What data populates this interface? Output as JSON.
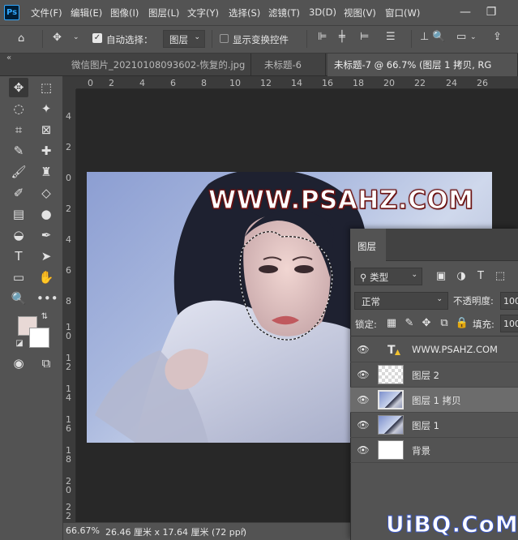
{
  "app": {
    "logo": "Ps"
  },
  "menu": [
    "文件(F)",
    "编辑(E)",
    "图像(I)",
    "图层(L)",
    "文字(Y)",
    "选择(S)",
    "滤镜(T)",
    "3D(D)",
    "视图(V)",
    "窗口(W)"
  ],
  "window_controls": {
    "minimize": "—",
    "restore": "❐"
  },
  "options_bar": {
    "auto_select_label": "自动选择：",
    "auto_select_checked": true,
    "auto_select_target": "图层",
    "show_transform_label": "显示变换控件",
    "show_transform_checked": false
  },
  "tabs": [
    {
      "label": "微信图片_20210108093602-恢复的.jpg",
      "active": false
    },
    {
      "label": "未标题-6",
      "active": false
    },
    {
      "label": "未标题-7 @ 66.7% (图层 1 拷贝, RG",
      "active": true
    }
  ],
  "ruler": {
    "top": [
      "0",
      "2",
      "4",
      "6",
      "8",
      "10",
      "12",
      "14",
      "16",
      "18",
      "20",
      "22",
      "24",
      "26"
    ],
    "left": [
      "4",
      "2",
      "0",
      "2",
      "4",
      "6",
      "8",
      "1\n0",
      "1\n2",
      "1\n4",
      "1\n6",
      "1\n8",
      "2\n0",
      "2\n2"
    ]
  },
  "canvas": {
    "watermark_text": "WWW.PSAHZ.COM"
  },
  "colors": {
    "foreground": "#e8d9d6",
    "background": "#ffffff"
  },
  "status": {
    "zoom": "66.67%",
    "doc_size": "26.46 厘米 x 17.64 厘米 (72 ppi)",
    "arrow": "›"
  },
  "layers_panel": {
    "title": "图层",
    "filter_kind": "类型",
    "blend_mode": "正常",
    "opacity_label": "不透明度:",
    "opacity_value": "100",
    "lock_label": "锁定:",
    "fill_label": "填充:",
    "fill_value": "100",
    "layers": [
      {
        "name": "WWW.PSAHZ.COM",
        "type": "text",
        "visible": true,
        "selected": false
      },
      {
        "name": "图层 2",
        "type": "transparent",
        "visible": true,
        "selected": false
      },
      {
        "name": "图层 1 拷贝",
        "type": "photo",
        "visible": true,
        "selected": true
      },
      {
        "name": "图层 1",
        "type": "photo",
        "visible": true,
        "selected": false
      },
      {
        "name": "背景",
        "type": "white",
        "visible": true,
        "selected": false
      }
    ]
  },
  "site_watermark": "UiBQ.CoM"
}
